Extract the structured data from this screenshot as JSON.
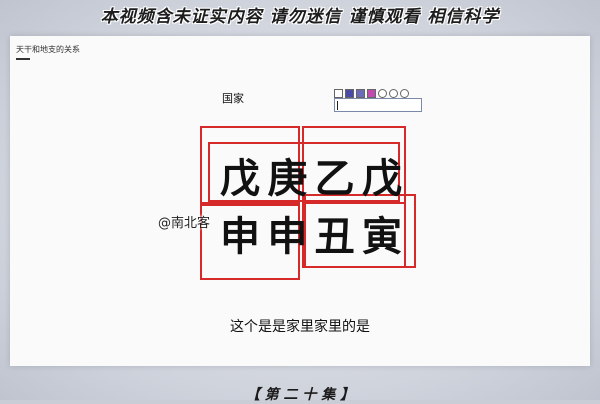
{
  "top_banner": "本视频含未证实内容 请勿迷信 谨慎观看 相信科学",
  "doc": {
    "title": "天干和地支的关系",
    "country_label": "国家"
  },
  "toolbar": {
    "swatches": [
      "#ffffff",
      "#4a4aa8",
      "#6b6bb8",
      "#c04ab0"
    ],
    "buttons": [
      "circle-icon",
      "circle-icon",
      "circle-icon"
    ]
  },
  "pillars": {
    "heavenly_stems": [
      "戊",
      "庚",
      "乙",
      "戊"
    ],
    "earthly_branches": [
      "申",
      "申",
      "丑",
      "寅"
    ]
  },
  "watermark": "@南北客",
  "subtitle": "这个是是家里家里的是",
  "bottom_banner": "【 第 二 十 集 】",
  "colors": {
    "box_red": "#d62a2a"
  }
}
